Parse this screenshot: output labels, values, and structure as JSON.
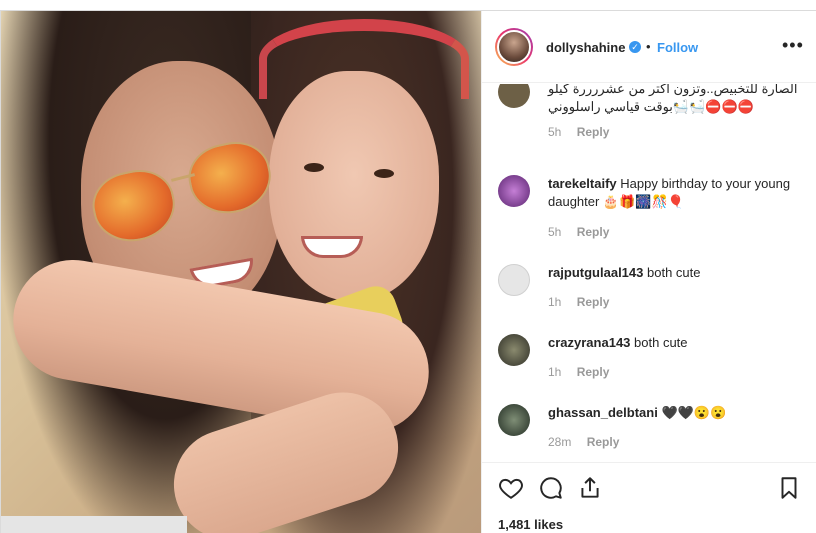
{
  "post": {
    "username": "dollyshahine",
    "follow_label": "Follow",
    "separator": "•",
    "more_label": "•••",
    "likes": "1,481 likes"
  },
  "comments": [
    {
      "username": "",
      "text": "الصارة للتخبيص..وتزون اكتر من عشررررة كيلو ⛔⛔⛔🛀🛀بوقت قياسي راسلووني",
      "time": "5h",
      "reply": "Reply",
      "avatar_color": "#6d6046"
    },
    {
      "username": "tarekeltaify",
      "text": "Happy birthday to your young daughter 🎂🎁🎆🎊🎈",
      "time": "5h",
      "reply": "Reply",
      "avatar_color": "#7a3f8e"
    },
    {
      "username": "rajputgulaal143",
      "text": "both cute",
      "time": "1h",
      "reply": "Reply",
      "avatar_color": "#dcdcdc"
    },
    {
      "username": "crazyrana143",
      "text": "both cute",
      "time": "1h",
      "reply": "Reply",
      "avatar_color": "#4a4a3c"
    },
    {
      "username": "ghassan_delbtani",
      "text": "🖤🖤😮😮",
      "time": "28m",
      "reply": "Reply",
      "avatar_color": "#3e4a3c"
    }
  ],
  "icons": {
    "like": "heart-icon",
    "comment": "speech-bubble-icon",
    "share": "share-icon",
    "save": "bookmark-icon",
    "verified": "verified-badge-icon",
    "more": "more-options-icon"
  },
  "colors": {
    "accent": "#3897f0",
    "border": "#efefef",
    "muted": "#999999"
  }
}
